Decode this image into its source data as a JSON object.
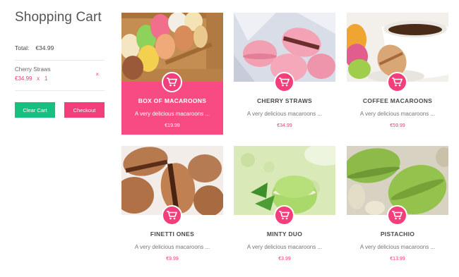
{
  "cart": {
    "title": "Shopping Cart",
    "total_label": "Total:",
    "total_value": "€34.99",
    "items": [
      {
        "name": "Cherry Straws",
        "price": "€34.99",
        "sep": "x",
        "qty": "1",
        "remove": "×"
      }
    ],
    "clear_label": "Clear Cart",
    "checkout_label": "Checkout"
  },
  "products": [
    {
      "name": "BOX OF MACAROONS",
      "desc": "A very delicious macaroons ...",
      "price": "€19.99"
    },
    {
      "name": "CHERRY STRAWS",
      "desc": "A very delicious macaroons ...",
      "price": "€34.99"
    },
    {
      "name": "COFFEE MACAROONS",
      "desc": "A very delicious macaroons ...",
      "price": "€59.99"
    },
    {
      "name": "FINETTI ONES",
      "desc": "A very delicious macaroons ...",
      "price": "€9.99"
    },
    {
      "name": "MINTY DUO",
      "desc": "A very delicious macaroons ...",
      "price": "€3.99"
    },
    {
      "name": "PISTACHIO",
      "desc": "A very delicious macaroons ...",
      "price": "€13.99"
    }
  ],
  "colors": {
    "accent": "#f23e7a",
    "clear_button": "#18c07f",
    "active_card": "#f84b83"
  },
  "icons": {
    "add_to_cart": "cart-icon"
  }
}
